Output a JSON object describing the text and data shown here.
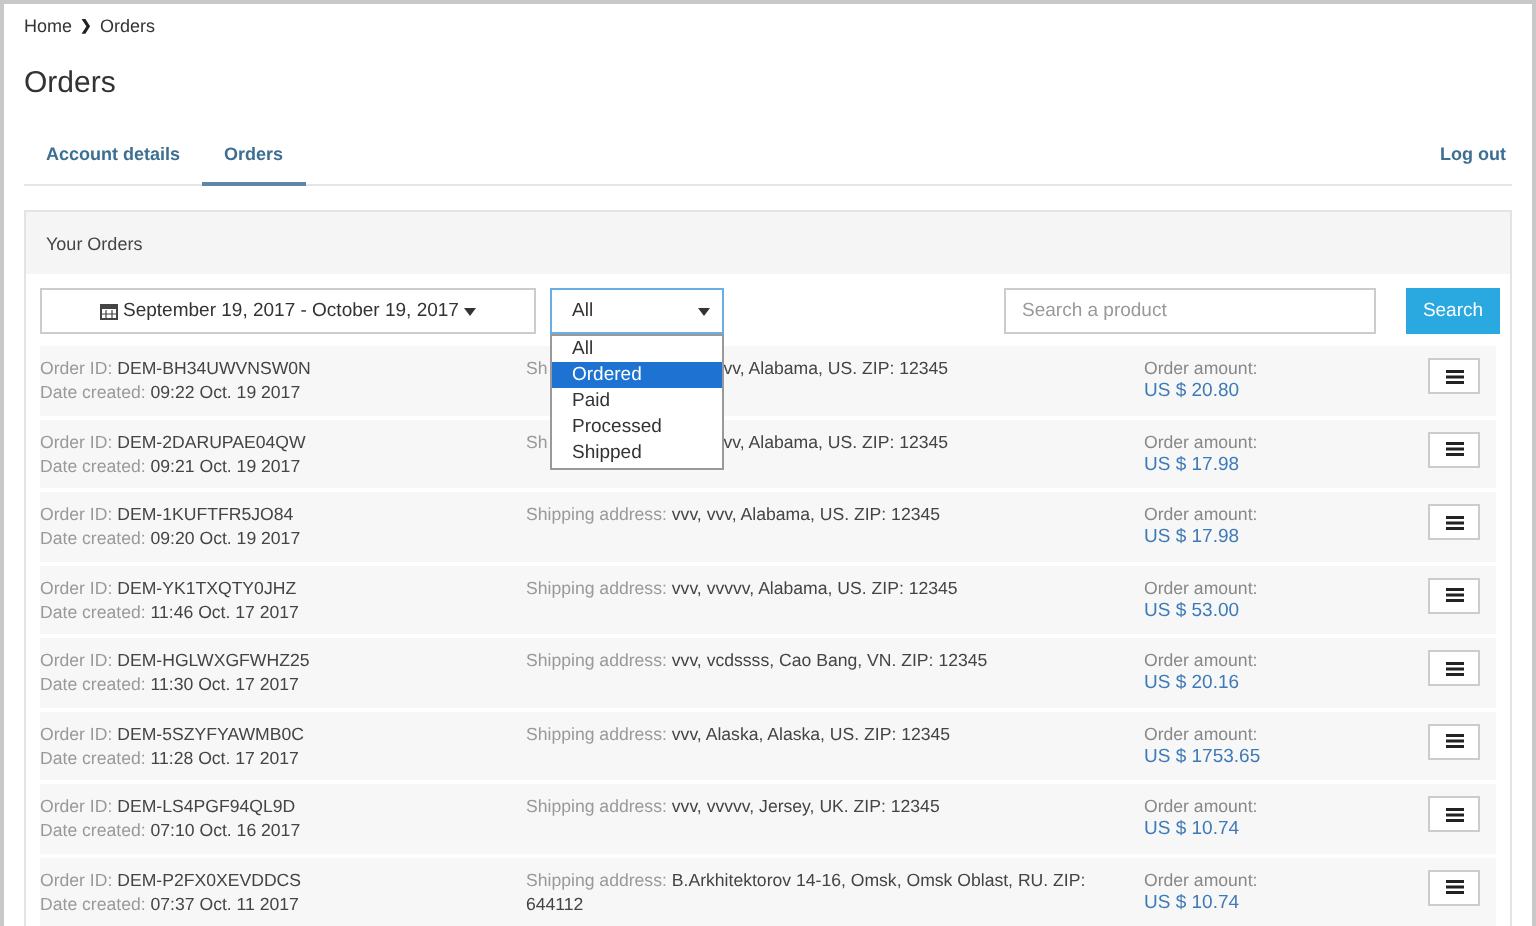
{
  "breadcrumb": {
    "home": "Home",
    "separator": "❯",
    "current": "Orders"
  },
  "title": "Orders",
  "tabs": [
    {
      "label": "Account details",
      "selected": false
    },
    {
      "label": "Orders",
      "selected": true
    }
  ],
  "logout": "Log out",
  "panel": {
    "title": "Your Orders"
  },
  "filters": {
    "date_range": "September 19, 2017 - October 19, 2017",
    "status": {
      "value": "All",
      "expanded": true,
      "options": [
        {
          "label": "All",
          "highlighted": false
        },
        {
          "label": "Ordered",
          "highlighted": true
        },
        {
          "label": "Paid",
          "highlighted": false
        },
        {
          "label": "Processed",
          "highlighted": false
        },
        {
          "label": "Shipped",
          "highlighted": false
        }
      ]
    },
    "search": {
      "placeholder": "Search a product"
    },
    "search_button": "Search"
  },
  "orders": [
    {
      "kind": "covered",
      "id_label": "Order ID:",
      "id": "DEM-BH34UWVNSW0N",
      "date_label": "Date created:",
      "date": "09:22 Oct. 19 2017",
      "address_label": "Sh",
      "address": "vv, Alabama, US. ZIP: 12345",
      "amount_label": "Order amount:",
      "amount": "US $ 20.80"
    },
    {
      "kind": "covered",
      "id_label": "Order ID:",
      "id": "DEM-2DARUPAE04QW",
      "date_label": "Date created:",
      "date": "09:21 Oct. 19 2017",
      "address_label": "Sh",
      "address": "vv, Alabama, US. ZIP: 12345",
      "amount_label": "Order amount:",
      "amount": "US $ 17.98"
    },
    {
      "kind": "plain",
      "id_label": "Order ID:",
      "id": "DEM-1KUFTFR5JO84",
      "date_label": "Date created:",
      "date": "09:20 Oct. 19 2017",
      "address_label": "Shipping address:",
      "address": "vvv, vvv, Alabama, US. ZIP: 12345",
      "amount_label": "Order amount:",
      "amount": "US $ 17.98"
    },
    {
      "kind": "plain",
      "id_label": "Order ID:",
      "id": "DEM-YK1TXQTY0JHZ",
      "date_label": "Date created:",
      "date": "11:46 Oct. 17 2017",
      "address_label": "Shipping address:",
      "address": "vvv, vvvvv, Alabama, US. ZIP: 12345",
      "amount_label": "Order amount:",
      "amount": "US $ 53.00"
    },
    {
      "kind": "plain",
      "id_label": "Order ID:",
      "id": "DEM-HGLWXGFWHZ25",
      "date_label": "Date created:",
      "date": "11:30 Oct. 17 2017",
      "address_label": "Shipping address:",
      "address": "vvv, vcdssss, Cao Bang, VN. ZIP: 12345",
      "amount_label": "Order amount:",
      "amount": "US $ 20.16"
    },
    {
      "kind": "plain",
      "id_label": "Order ID:",
      "id": "DEM-5SZYFYAWMB0C",
      "date_label": "Date created:",
      "date": "11:28 Oct. 17 2017",
      "address_label": "Shipping address:",
      "address": "vvv, Alaska, Alaska, US. ZIP: 12345",
      "amount_label": "Order amount:",
      "amount": "US $ 1753.65"
    },
    {
      "kind": "plain",
      "id_label": "Order ID:",
      "id": "DEM-LS4PGF94QL9D",
      "date_label": "Date created:",
      "date": "07:10 Oct. 16 2017",
      "address_label": "Shipping address:",
      "address": "vvv, vvvvv, Jersey, UK. ZIP: 12345",
      "amount_label": "Order amount:",
      "amount": "US $ 10.74"
    },
    {
      "kind": "plain",
      "id_label": "Order ID:",
      "id": "DEM-P2FX0XEVDDCS",
      "date_label": "Date created:",
      "date": "07:37 Oct. 11 2017",
      "address_label": "Shipping address:",
      "address": "B.Arkhitektorov 14-16, Omsk, Omsk Oblast, RU. ZIP: 644112",
      "amount_label": "Order amount:",
      "amount": "US $ 10.74"
    }
  ]
}
